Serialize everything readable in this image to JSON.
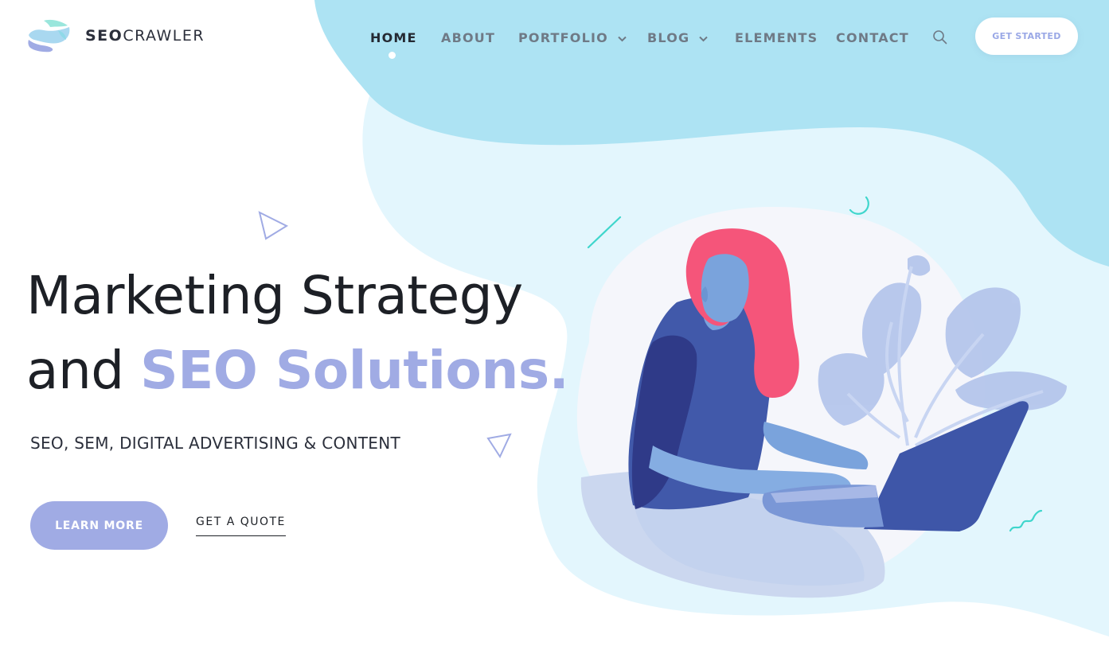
{
  "brand": {
    "name_bold": "SEO",
    "name_rest": "CRAWLER",
    "logo_icon": "logo-s-icon"
  },
  "nav": {
    "items": [
      {
        "label": "HOME",
        "active": true
      },
      {
        "label": "ABOUT"
      },
      {
        "label": "PORTFOLIO",
        "has_dropdown": true
      },
      {
        "label": "BLOG",
        "has_dropdown": true
      },
      {
        "label": "ELEMENTS"
      },
      {
        "label": "CONTACT"
      }
    ],
    "search_icon": "search-icon",
    "cta_label": "GET STARTED"
  },
  "hero": {
    "title_line1": "Marketing Strategy",
    "title_line2_plain": "and ",
    "title_line2_accent": "SEO Solutions.",
    "subtitle": "SEO, SEM, DIGITAL ADVERTISING & CONTENT",
    "primary_button": "LEARN MORE",
    "secondary_button": "GET A QUOTE"
  },
  "colors": {
    "accent": "#a0abe4",
    "blob_dark": "#ade3f3",
    "blob_light": "#e3f6fd",
    "text_dark": "#1d2026",
    "nav_text": "#6f7a86"
  },
  "illustration": {
    "subject": "woman-using-laptop-illustration"
  }
}
